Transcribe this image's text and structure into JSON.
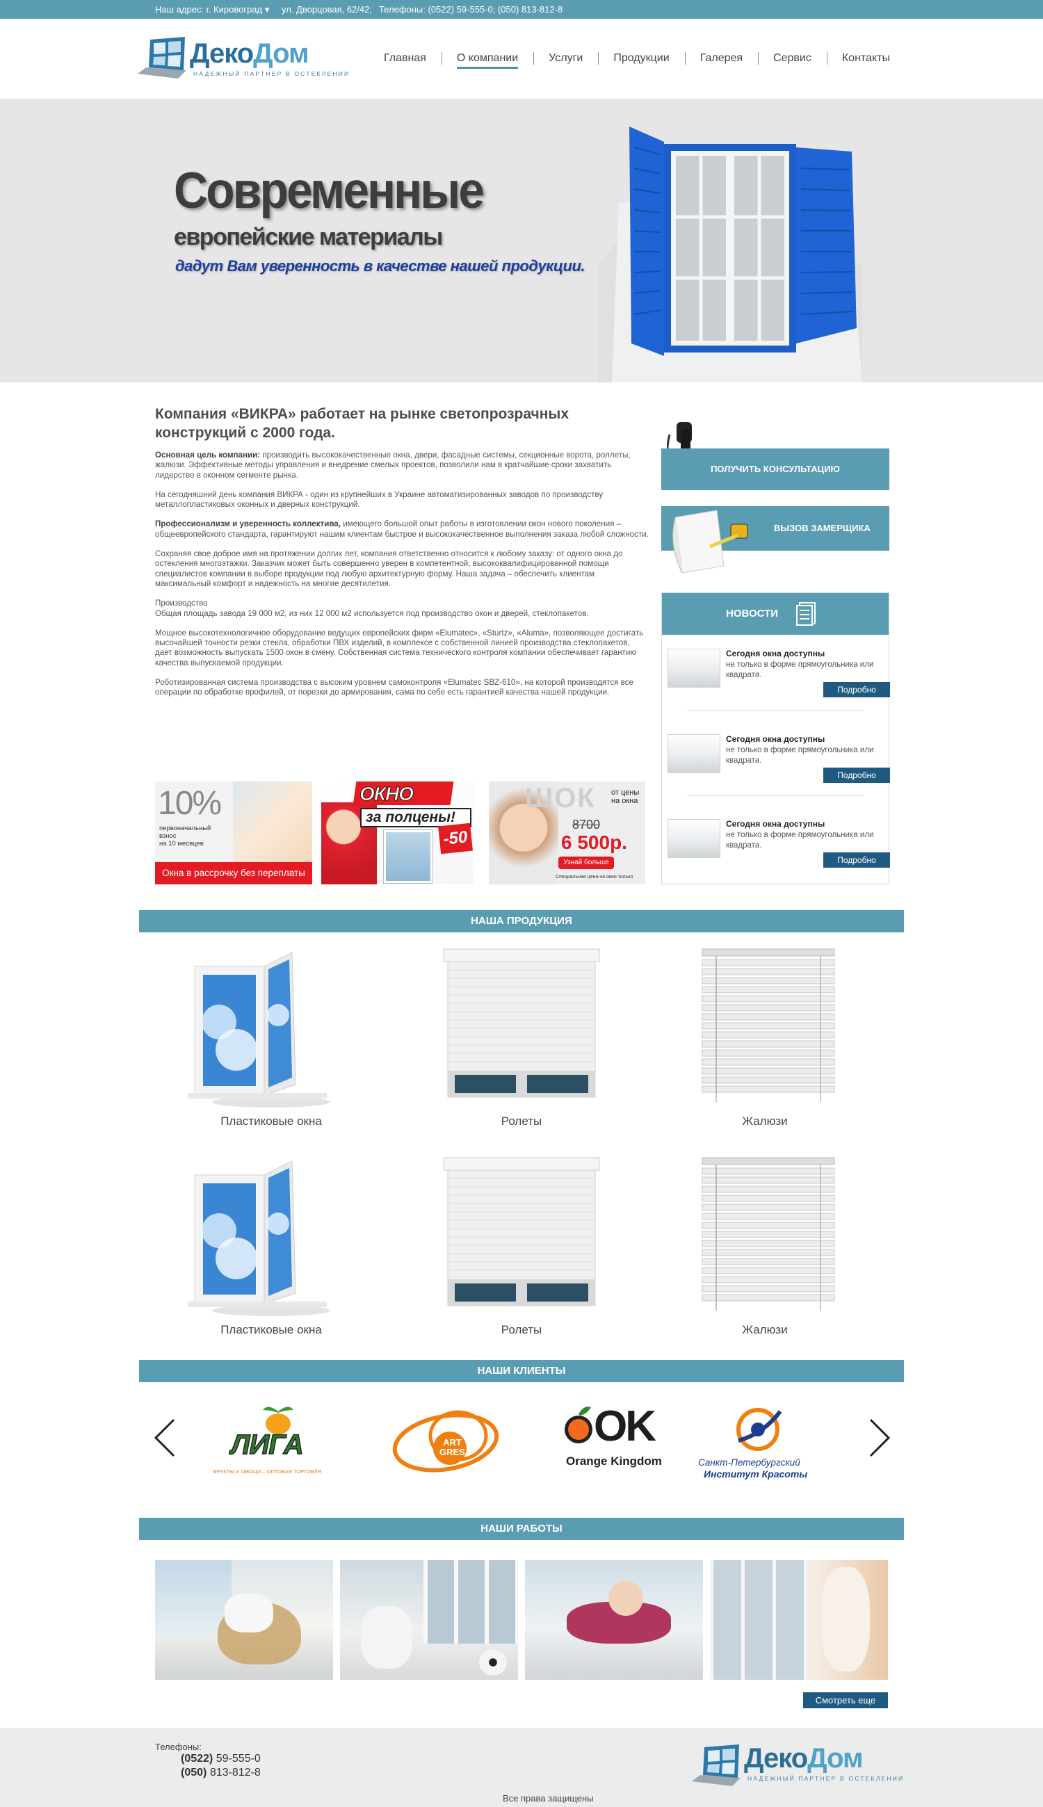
{
  "topbar": {
    "address": "Наш адрес: г. Кировоград ▾",
    "street": "ул. Дворцовая, 62/42;",
    "phones": "Телефоны: (0522) 59-555-0; (050) 813-812-8"
  },
  "logo": {
    "name_part1": "Деко",
    "name_part2": "Дом",
    "tagline": "надежный партнер в остеклении"
  },
  "nav": {
    "items": [
      "Главная",
      "О компании",
      "Услуги",
      "Продукции",
      "Галерея",
      "Сервис",
      "Контакты"
    ],
    "active": "О компании"
  },
  "hero": {
    "line1": "Современные",
    "line2": "европейские материалы",
    "line3": "дадут Вам уверенность в качестве нашей продукции."
  },
  "about": {
    "title": "Компания «ВИКРА» работает на рынке светопрозрачных конструкций с 2000 года.",
    "p1_bold": "Основная цель компании:",
    "p1": " производить высококачественные окна, двери, фасадные системы, секционные ворота, роллеты, жалюзи. Эффективные методы управления и внедрение смелых проектов, позволили нам в кратчайшие сроки захватить лидерство в оконном сегменте рынка.",
    "p2": "На сегодняшний день компания ВИКРА - один из крупнейших в Украине автоматизированных заводов по производству металлопластиковых оконных и дверных конструкций.",
    "p3_bold": "Профессионализм и уверенность коллектива,",
    "p3": " имеющего большой опыт работы в изготовлении окон нового поколения – общеевропейского стандарта, гарантируют нашим клиентам быстрое и высококачественное выполнения заказа любой сложности.",
    "p4": "Сохраняя свое доброе имя на протяжении долгих лет, компания ответственно относится к любому заказу: от одного окна до остекления многоэтажки. Заказчик может быть совершенно уверен в компетентной, высококвалифицированной помощи специалистов компании в выборе продукции под любую архитектурную форму. Наша задача – обеспечить клиентам максимальный комфорт и надежность на многие десятилетия.",
    "p5_head": "Производство",
    "p5": "Общая площадь завода 19 000 м2, из них 12 000 м2 используется под производство окон и дверей, стеклопакетов.",
    "p6": "Мощное высокотехнологичное оборудование ведущих европейских фирм «Elumatec», «Sturtz», «Aluma», позволяющее достигать высочайшей точности резки стекла, обработки ПВХ изделий, в комплексе с собственной линией производства стеклопакетов, дает возможность выпускать 1500 окон в смену. Собственная система технического контроля компании обеспечивает гарантию качества выпускаемой продукции.",
    "p7": "Роботизированная система производства с высоким уровнем самоконтроля «Elumatec SBZ-610», на которой производятся все операции по обработке профилей, от порезки до армирования, сама по себе есть гарантией качества нашей продукции."
  },
  "promos": {
    "p1_big": "10%",
    "p1_line1": "первоначальный",
    "p1_line2": "взнос",
    "p1_line3": "на 10 месяцев",
    "p1_banner": "Окна в рассрочку без переплаты",
    "p2_line1": "ОКНО",
    "p2_line2": "за полцены!",
    "p2_badge": "-50",
    "p3_shok": "ШОК",
    "p3_from": "от цены",
    "p3_on": "на окна",
    "p3_old": "8700",
    "p3_new": "6 500р.",
    "p3_btn": "Узнай больше",
    "p3_small": "Специальная цена на окно только"
  },
  "sidebar": {
    "consult": "ПОЛУЧИТЬ КОНСУЛЬТАЦИЮ",
    "measure": "ВЫЗОВ  ЗАМЕРЩИКА",
    "news_title": "НОВОСТИ",
    "news": [
      {
        "title": "Сегодня окна доступны",
        "text": "не только в форме прямоугольника или квадрата.",
        "more": "Подробно"
      },
      {
        "title": "Сегодня окна доступны",
        "text": "не только в форме прямоугольника или квадрата.",
        "more": "Подробно"
      },
      {
        "title": "Сегодня окна доступны",
        "text": "не только в форме прямоугольника или квадрата.",
        "more": "Подробно"
      }
    ]
  },
  "products": {
    "title": "НАША ПРОДУКЦИЯ",
    "items": [
      "Пластиковые окна",
      "Ролеты",
      "Жалюзи",
      "Пластиковые окна",
      "Ролеты",
      "Жалюзи"
    ]
  },
  "clients": {
    "title": "НАШИ КЛИЕНТЫ",
    "liga": "ЛИГА",
    "liga_sub": "ФРУКТЫ И ОВОЩИ – ОПТОВАЯ ТОРГОВЛЯ",
    "art1": "ART",
    "art2": "GRES",
    "ok": "OK",
    "ok_sub": "Orange Kingdom",
    "spb1": "Санкт-Петербургский",
    "spb2": "Институт Красоты"
  },
  "works": {
    "title": "НАШИ РАБОТЫ",
    "more": "Смотреть еще"
  },
  "footer": {
    "phones_label": "Телефоны:",
    "phone1_code": "(0522)",
    "phone1": "59-555-0",
    "phone2_code": "(050)",
    "phone2": "813-812-8",
    "copyright": "Все права защищены"
  },
  "colors": {
    "accent": "#5a9db3",
    "dark_button": "#1f5b81",
    "hero_bg": "#e6e6e6",
    "footer_bg": "#ececec"
  }
}
